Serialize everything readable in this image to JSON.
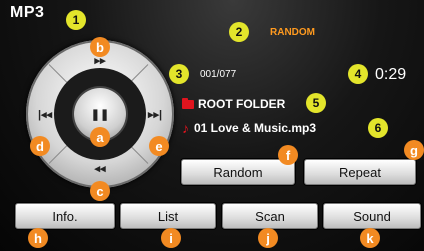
{
  "header": {
    "mode": "MP3",
    "random_status": "RANDOM"
  },
  "track": {
    "counter": "001/077",
    "time": "0:29",
    "folder": "ROOT FOLDER",
    "file": "01 Love & Music.mp3"
  },
  "wheel": {
    "fast_forward_glyph": "▸▸",
    "rewind_glyph": "◂◂",
    "previous_glyph": "|◂◂",
    "next_glyph": "▸▸|",
    "pause_glyph": "❚❚"
  },
  "buttons": {
    "random": "Random",
    "repeat": "Repeat",
    "info": "Info.",
    "list": "List",
    "scan": "Scan",
    "sound": "Sound"
  },
  "callouts": {
    "c1": "1",
    "c2": "2",
    "c3": "3",
    "c4": "4",
    "c5": "5",
    "c6": "6",
    "ca": "a",
    "cb": "b",
    "cc": "c",
    "cd": "d",
    "ce": "e",
    "cf": "f",
    "cg": "g",
    "ch": "h",
    "ci": "i",
    "cj": "j",
    "ck": "k"
  },
  "colors": {
    "accent_orange": "#f28a22",
    "callout_yellow": "#e3e52b",
    "folder_red": "#e0141e",
    "random_text": "#ff9a1f"
  }
}
